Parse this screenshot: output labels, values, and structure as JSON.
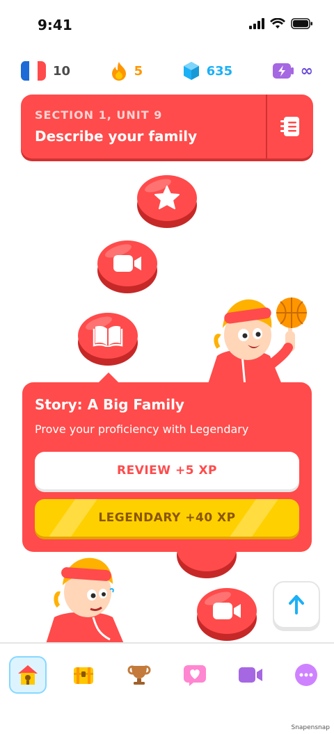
{
  "status_bar": {
    "time": "9:41"
  },
  "stats": {
    "language_streak": "10",
    "fire": "5",
    "gems": "635",
    "energy": "∞"
  },
  "unit": {
    "section": "SECTION 1, UNIT 9",
    "title": "Describe your family"
  },
  "popup": {
    "title": "Story: A Big Family",
    "subtitle": "Prove your proficiency with Legendary",
    "review_label": "REVIEW +5 XP",
    "legendary_label": "LEGENDARY +40 XP"
  },
  "nav": {
    "items": [
      "home-icon",
      "chest-icon",
      "trophy-icon",
      "heart-icon",
      "video-icon",
      "more-icon"
    ]
  },
  "colors": {
    "primary_red": "#ff4b4b",
    "gold": "#ffd000",
    "blue": "#1cb0f6",
    "orange": "#ff9600",
    "purple": "#6a4bd8"
  },
  "watermark": "Snapensnap"
}
